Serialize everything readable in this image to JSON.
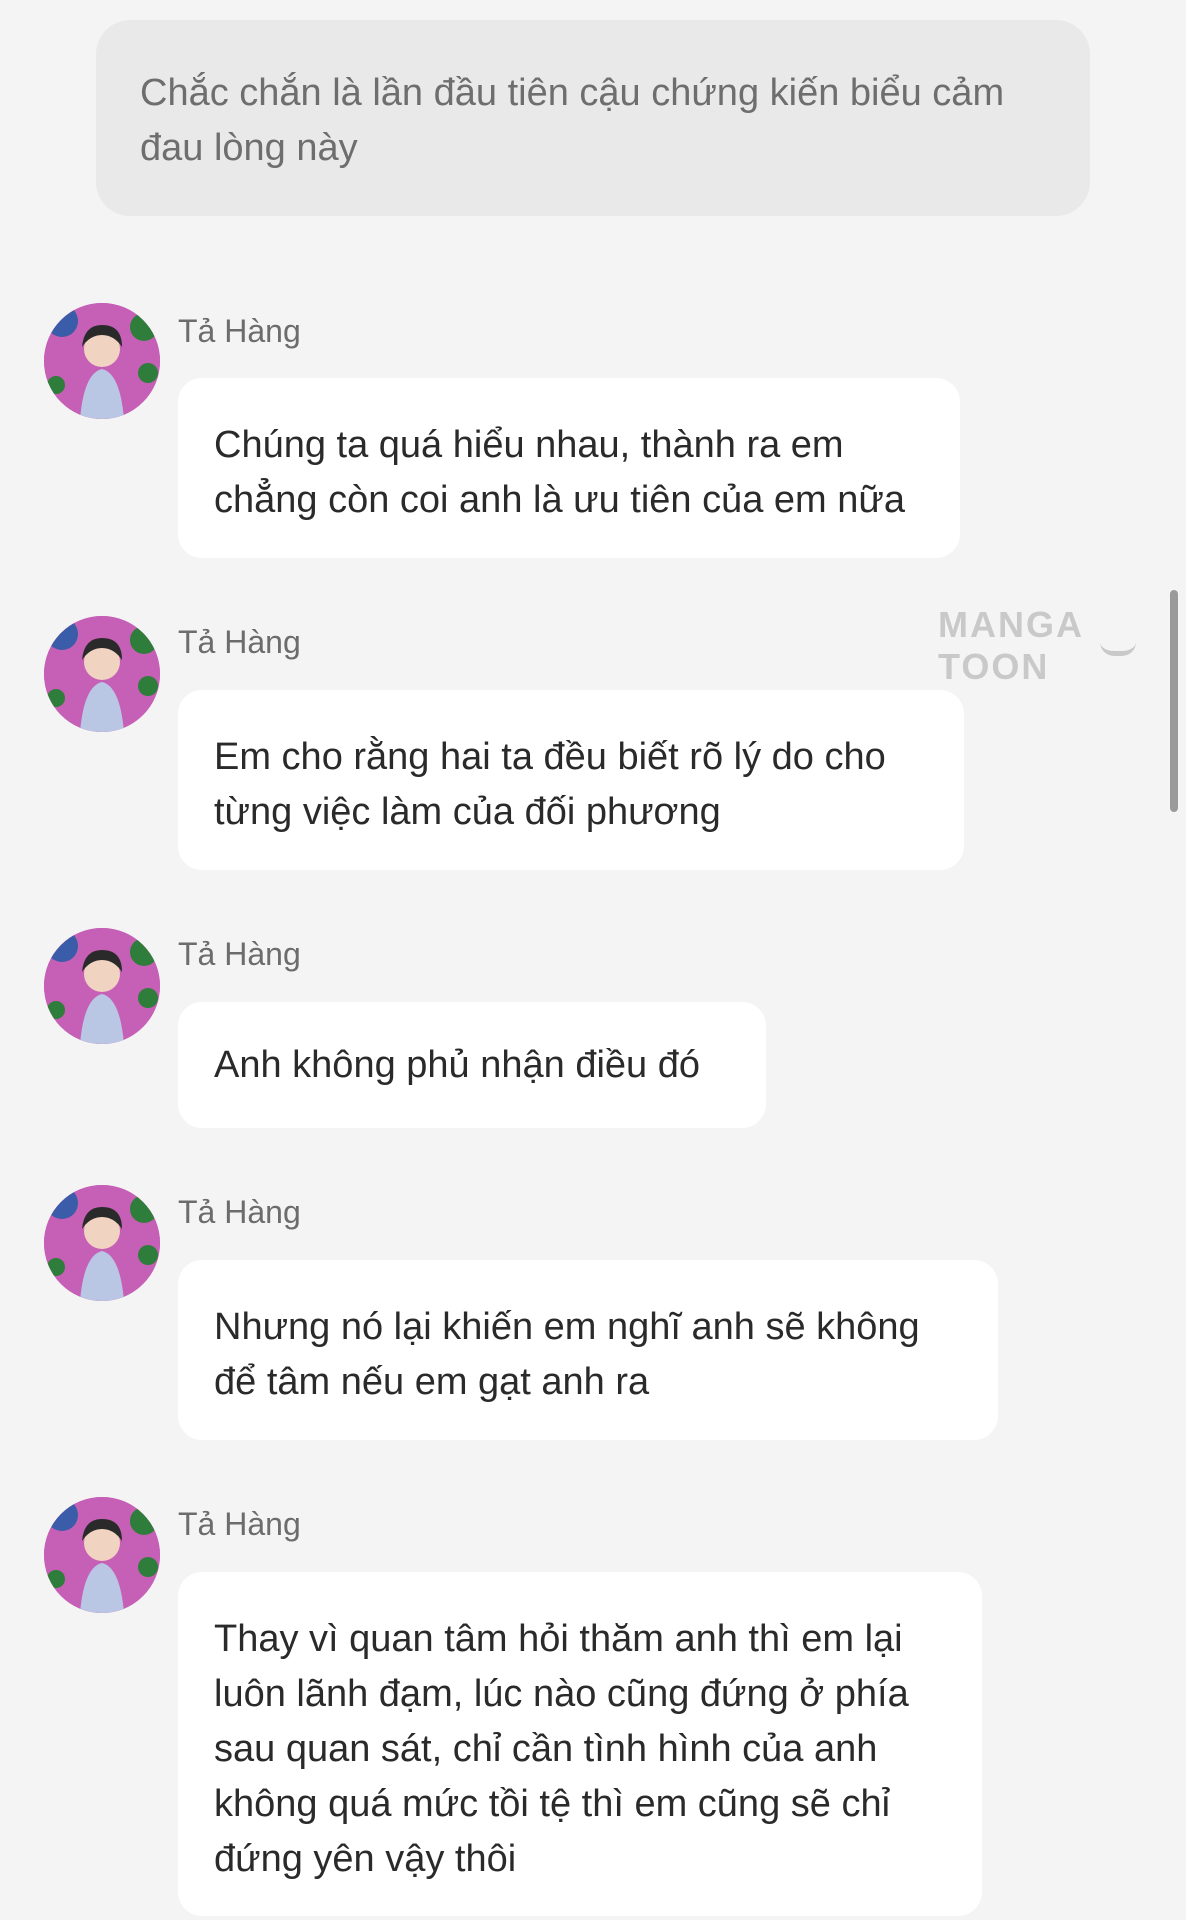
{
  "narration": {
    "text": "Chắc chắn là lần đầu tiên cậu chứng kiến biểu cảm đau lòng này"
  },
  "messages": [
    {
      "sender": "Tả Hàng",
      "text": "Chúng ta quá hiểu nhau, thành ra em chẳng còn coi anh là ưu tiên của em nữa"
    },
    {
      "sender": "Tả Hàng",
      "text": "Em cho rằng hai ta đều biết rõ lý do cho từng việc làm của đối phương"
    },
    {
      "sender": "Tả Hàng",
      "text": "Anh không phủ nhận điều đó"
    },
    {
      "sender": "Tả Hàng",
      "text": "Nhưng nó lại khiến em nghĩ anh sẽ không để tâm nếu em gạt anh ra"
    },
    {
      "sender": "Tả Hàng",
      "text": "Thay vì quan tâm hỏi thăm anh thì em lại luôn lãnh đạm, lúc nào cũng đứng ở phía sau quan sát, chỉ cần tình hình của anh không quá mức tồi tệ thì em cũng sẽ chỉ đứng yên vậy thôi"
    }
  ],
  "watermark": {
    "text": "MANGA TOON"
  },
  "colors": {
    "background": "#f4f4f4",
    "narration_bubble": "#e9e9e9",
    "message_bubble": "#ffffff",
    "avatar_bg": "#c65fb6"
  }
}
